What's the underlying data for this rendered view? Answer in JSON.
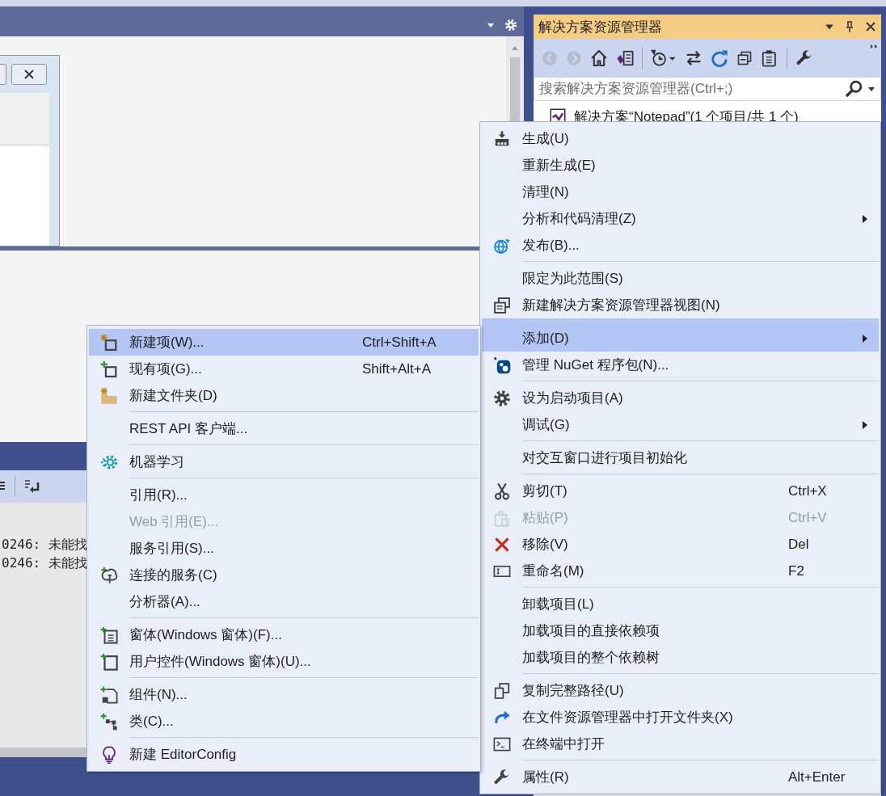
{
  "solution_explorer": {
    "title": "解决方案资源管理器",
    "back_button": {
      "disabled": true
    },
    "forward_button": {
      "disabled": true
    },
    "search": {
      "placeholder": "搜索解决方案资源管理器(Ctrl+;)"
    },
    "tree": [
      {
        "label": "解决方案“Notepad”(1 个项目/共 1 个)"
      }
    ]
  },
  "output": {
    "lines": [
      "0246: 未能找",
      "0246: 未能找"
    ]
  },
  "context_menu": {
    "items": [
      {
        "label": "生成(U)",
        "selected": false,
        "disabled": false,
        "submenu": false,
        "separator_before": false
      },
      {
        "label": "重新生成(E)",
        "selected": false,
        "disabled": false,
        "submenu": false,
        "separator_before": false
      },
      {
        "label": "清理(N)",
        "selected": false,
        "disabled": false,
        "submenu": false,
        "separator_before": false
      },
      {
        "label": "分析和代码清理(Z)",
        "selected": false,
        "disabled": false,
        "submenu": true,
        "separator_before": false
      },
      {
        "label": "发布(B)...",
        "selected": false,
        "disabled": false,
        "submenu": false,
        "separator_before": false
      },
      {
        "label": "限定为此范围(S)",
        "selected": false,
        "disabled": false,
        "submenu": false,
        "separator_before": true
      },
      {
        "label": "新建解决方案资源管理器视图(N)",
        "selected": false,
        "disabled": false,
        "submenu": false,
        "separator_before": false
      },
      {
        "label": "添加(D)",
        "selected": true,
        "disabled": false,
        "submenu": true,
        "separator_before": true
      },
      {
        "label": "管理 NuGet 程序包(N)...",
        "selected": false,
        "disabled": false,
        "submenu": false,
        "separator_before": false
      },
      {
        "label": "设为启动项目(A)",
        "selected": false,
        "disabled": false,
        "submenu": false,
        "separator_before": true
      },
      {
        "label": "调试(G)",
        "selected": false,
        "disabled": false,
        "submenu": true,
        "separator_before": false
      },
      {
        "label": "对交互窗口进行项目初始化",
        "selected": false,
        "disabled": false,
        "submenu": false,
        "separator_before": true
      },
      {
        "label": "剪切(T)",
        "shortcut": "Ctrl+X",
        "selected": false,
        "disabled": false,
        "submenu": false,
        "separator_before": true
      },
      {
        "label": "粘贴(P)",
        "shortcut": "Ctrl+V",
        "selected": false,
        "disabled": true,
        "submenu": false,
        "separator_before": false
      },
      {
        "label": "移除(V)",
        "shortcut": "Del",
        "selected": false,
        "disabled": false,
        "submenu": false,
        "separator_before": false
      },
      {
        "label": "重命名(M)",
        "shortcut": "F2",
        "selected": false,
        "disabled": false,
        "submenu": false,
        "separator_before": false
      },
      {
        "label": "卸载项目(L)",
        "selected": false,
        "disabled": false,
        "submenu": false,
        "separator_before": true
      },
      {
        "label": "加载项目的直接依赖项",
        "selected": false,
        "disabled": false,
        "submenu": false,
        "separator_before": false
      },
      {
        "label": "加载项目的整个依赖树",
        "selected": false,
        "disabled": false,
        "submenu": false,
        "separator_before": false
      },
      {
        "label": "复制完整路径(U)",
        "selected": false,
        "disabled": false,
        "submenu": false,
        "separator_before": true
      },
      {
        "label": "在文件资源管理器中打开文件夹(X)",
        "selected": false,
        "disabled": false,
        "submenu": false,
        "separator_before": false
      },
      {
        "label": "在终端中打开",
        "selected": false,
        "disabled": false,
        "submenu": false,
        "separator_before": false
      },
      {
        "label": "属性(R)",
        "shortcut": "Alt+Enter",
        "selected": false,
        "disabled": false,
        "submenu": false,
        "separator_before": true
      }
    ]
  },
  "add_submenu": {
    "items": [
      {
        "label": "新建项(W)...",
        "shortcut": "Ctrl+Shift+A",
        "selected": true,
        "disabled": false,
        "separator_before": false
      },
      {
        "label": "现有项(G)...",
        "shortcut": "Shift+Alt+A",
        "selected": false,
        "disabled": false,
        "separator_before": false
      },
      {
        "label": "新建文件夹(D)",
        "selected": false,
        "disabled": false,
        "separator_before": false
      },
      {
        "label": "REST API 客户端...",
        "selected": false,
        "disabled": false,
        "separator_before": true
      },
      {
        "label": "机器学习",
        "selected": false,
        "disabled": false,
        "separator_before": true
      },
      {
        "label": "引用(R)...",
        "selected": false,
        "disabled": false,
        "separator_before": true
      },
      {
        "label": "Web 引用(E)...",
        "selected": false,
        "disabled": true,
        "separator_before": false
      },
      {
        "label": "服务引用(S)...",
        "selected": false,
        "disabled": false,
        "separator_before": false
      },
      {
        "label": "连接的服务(C)",
        "selected": false,
        "disabled": false,
        "separator_before": false
      },
      {
        "label": "分析器(A)...",
        "selected": false,
        "disabled": false,
        "separator_before": false
      },
      {
        "label": "窗体(Windows 窗体)(F)...",
        "selected": false,
        "disabled": false,
        "separator_before": true
      },
      {
        "label": "用户控件(Windows 窗体)(U)...",
        "selected": false,
        "disabled": false,
        "separator_before": false
      },
      {
        "label": "组件(N)...",
        "selected": false,
        "disabled": false,
        "separator_before": true
      },
      {
        "label": "类(C)...",
        "selected": false,
        "disabled": false,
        "separator_before": false
      },
      {
        "label": "新建 EditorConfig",
        "selected": false,
        "disabled": false,
        "separator_before": true
      }
    ]
  }
}
